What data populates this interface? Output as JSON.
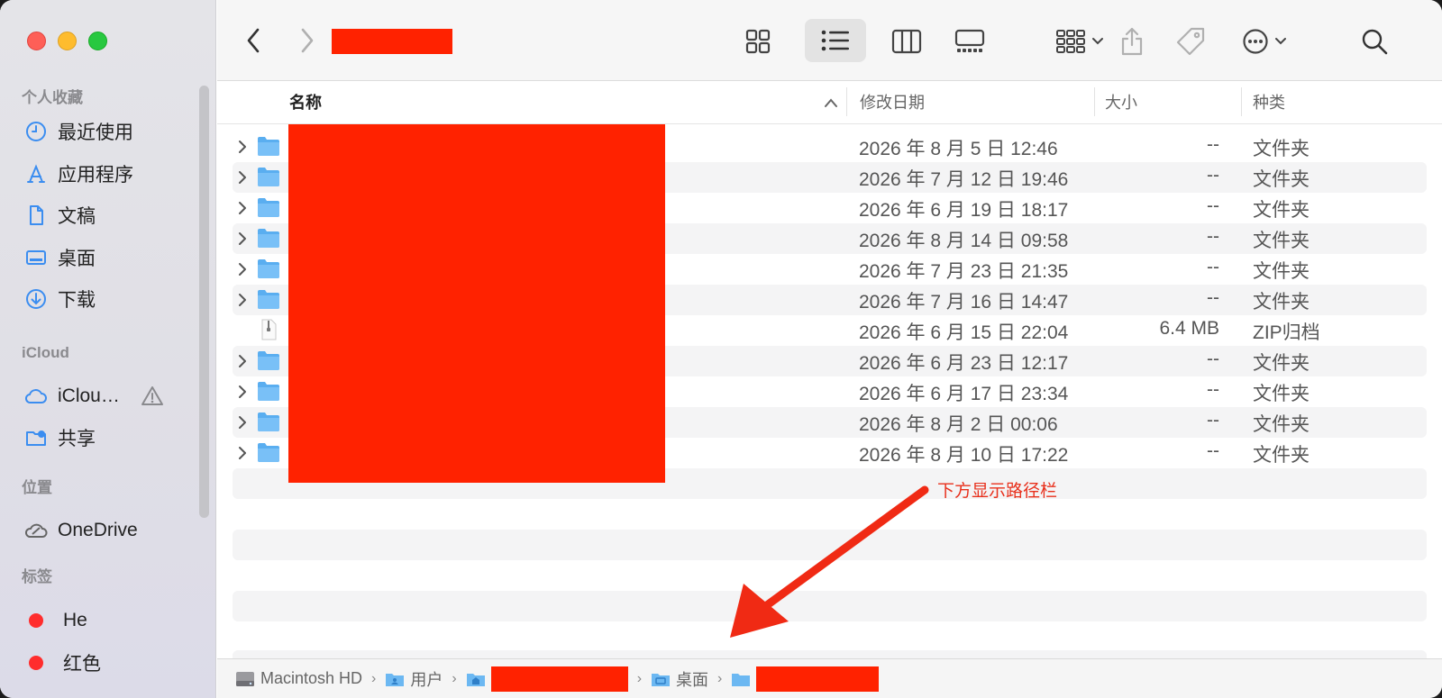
{
  "sidebar": {
    "favorites_header": "个人收藏",
    "favorites": [
      {
        "label": "最近使用",
        "icon": "clock-icon"
      },
      {
        "label": "应用程序",
        "icon": "apps-icon"
      },
      {
        "label": "文稿",
        "icon": "document-icon"
      },
      {
        "label": "桌面",
        "icon": "desktop-icon"
      },
      {
        "label": "下载",
        "icon": "download-icon"
      }
    ],
    "icloud_header": "iCloud",
    "icloud": [
      {
        "label": "iClou…",
        "icon": "cloud-icon"
      },
      {
        "label": "共享",
        "icon": "shared-folder-icon"
      }
    ],
    "locations_header": "位置",
    "locations": [
      {
        "label": "OneDrive",
        "icon": "onedrive-cloud-icon"
      }
    ],
    "tags_header": "标签",
    "tags": [
      {
        "label": "He",
        "color": "#ff2d2d"
      },
      {
        "label": "红色",
        "color": "#ff2d2d"
      }
    ]
  },
  "columns": {
    "name": "名称",
    "modified": "修改日期",
    "size": "大小",
    "kind": "种类"
  },
  "files": [
    {
      "type": "folder",
      "date": "2026 年 8 月 5 日 12:46",
      "size": "--",
      "kind": "文件夹"
    },
    {
      "type": "folder",
      "date": "2026 年 7 月 12 日 19:46",
      "size": "--",
      "kind": "文件夹"
    },
    {
      "type": "folder",
      "date": "2026 年 6 月 19 日 18:17",
      "size": "--",
      "kind": "文件夹"
    },
    {
      "type": "folder",
      "date": "2026 年 8 月 14 日 09:58",
      "size": "--",
      "kind": "文件夹"
    },
    {
      "type": "folder",
      "date": "2026 年 7 月 23 日 21:35",
      "size": "--",
      "kind": "文件夹"
    },
    {
      "type": "folder",
      "date": "2026 年 7 月 16 日 14:47",
      "size": "--",
      "kind": "文件夹"
    },
    {
      "type": "zip",
      "date": "2026 年 6 月 15 日 22:04",
      "size": "6.4 MB",
      "kind": "ZIP归档"
    },
    {
      "type": "folder",
      "date": "2026 年 6 月 23 日 12:17",
      "size": "--",
      "kind": "文件夹"
    },
    {
      "type": "folder",
      "date": "2026 年 6 月 17 日 23:34",
      "size": "--",
      "kind": "文件夹"
    },
    {
      "type": "folder",
      "date": "2026 年 8 月 2 日 00:06",
      "size": "--",
      "kind": "文件夹"
    },
    {
      "type": "folder",
      "date": "2026 年 8 月 10 日 17:22",
      "size": "--",
      "kind": "文件夹"
    }
  ],
  "annotation": "下方显示路径栏",
  "pathbar": {
    "disk": "Macintosh HD",
    "users": "用户",
    "desktop": "桌面"
  },
  "colors": {
    "accent": "#3b8df0",
    "redaction": "#ff2200",
    "annotation": "#e8301c"
  }
}
